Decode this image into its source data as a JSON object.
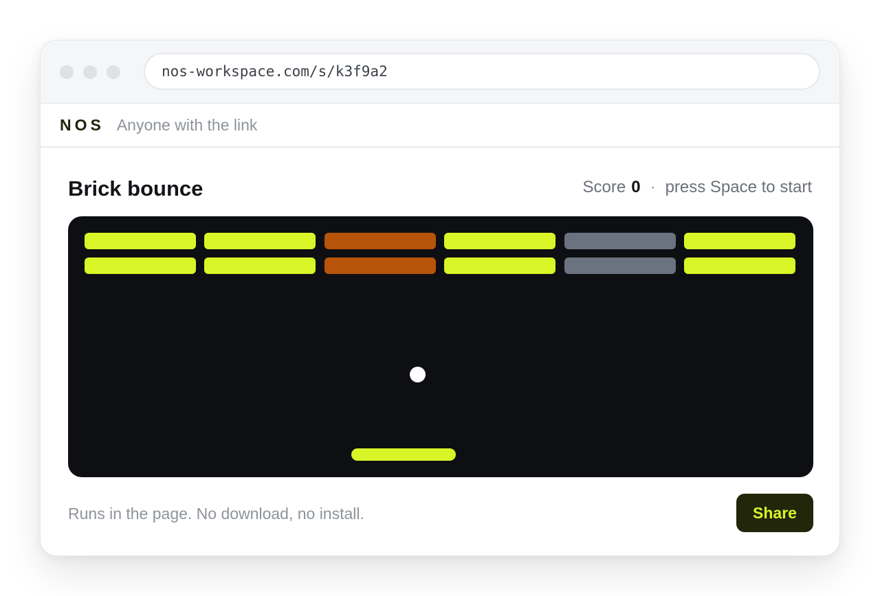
{
  "browser": {
    "url": "nos-workspace.com/s/k3f9a2",
    "window_controls": [
      "close-dot",
      "minimize-dot",
      "maximize-dot"
    ]
  },
  "topbar": {
    "brand": "NOS",
    "access_label": "Anyone with the link"
  },
  "game": {
    "title": "Brick bounce",
    "score_label": "Score",
    "score_value": "0",
    "separator": "·",
    "hint": "press Space to start",
    "brick_rows": [
      [
        "lime",
        "lime",
        "orange",
        "lime",
        "gray",
        "lime"
      ],
      [
        "lime",
        "lime",
        "orange",
        "lime",
        "gray",
        "lime"
      ]
    ]
  },
  "footer": {
    "note": "Runs in the page. No download, no install.",
    "share_label": "Share"
  },
  "colors": {
    "accent": "#d8f627",
    "lime": "#d8f627",
    "orange": "#b8540a",
    "gray": "#6b7280",
    "board_bg": "#0e0f12",
    "share_bg": "#22260a"
  }
}
